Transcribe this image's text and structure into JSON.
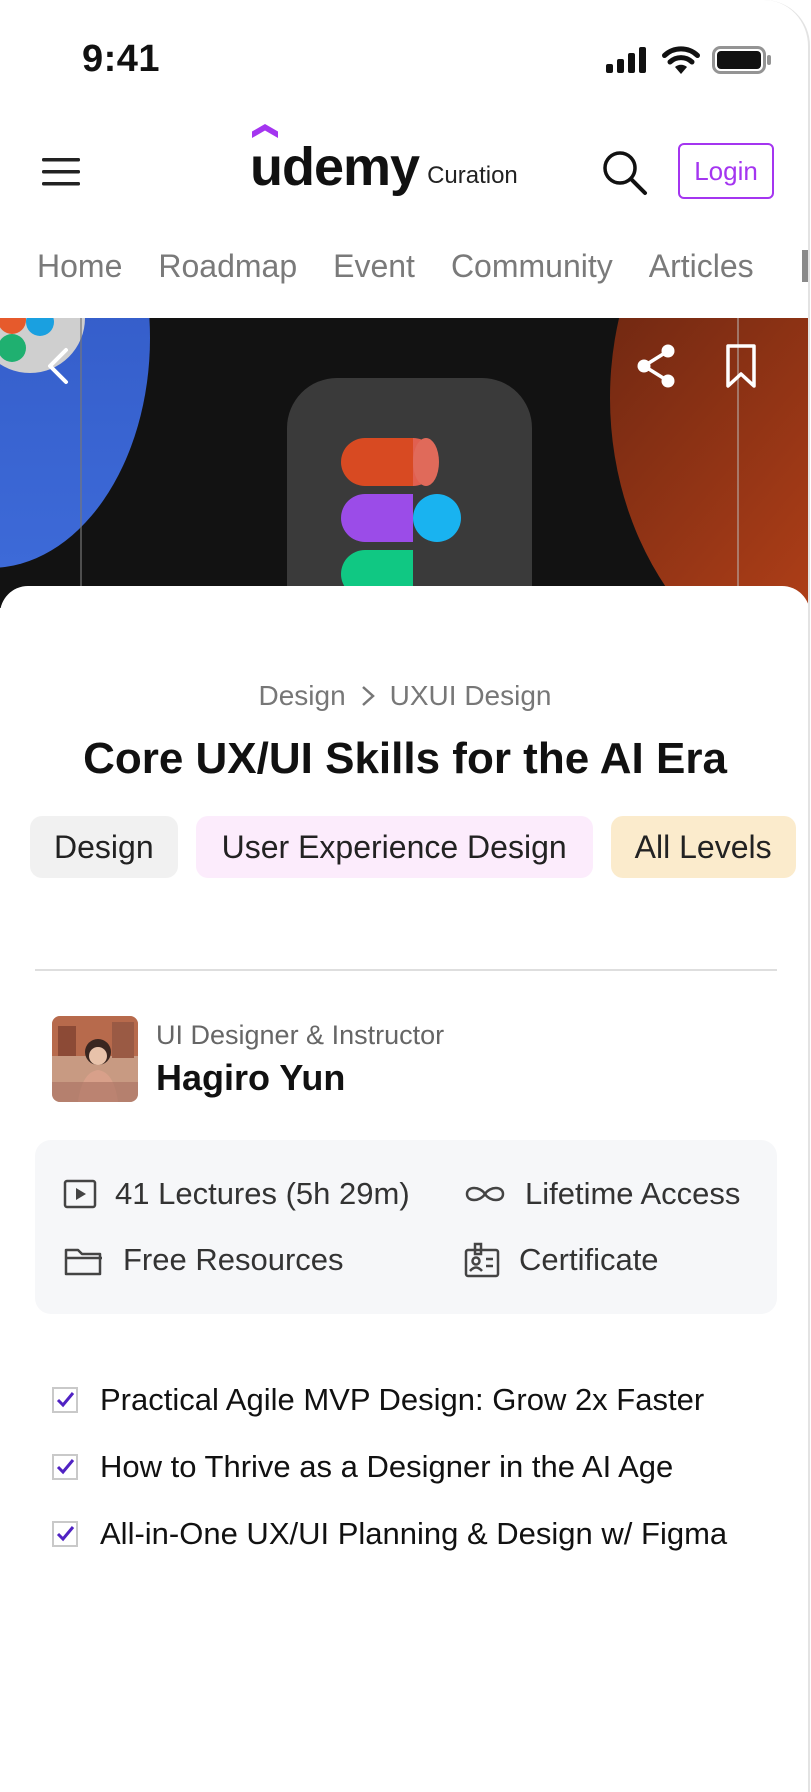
{
  "status_bar": {
    "time": "9:41"
  },
  "header": {
    "logo_word": "udemy",
    "logo_sub": "Curation",
    "login_label": "Login"
  },
  "tabs": [
    {
      "label": "Home"
    },
    {
      "label": "Roadmap"
    },
    {
      "label": "Event"
    },
    {
      "label": "Community"
    },
    {
      "label": "Articles"
    }
  ],
  "hero": {
    "icons": [
      "back-icon",
      "share-icon",
      "bookmark-icon"
    ]
  },
  "course": {
    "breadcrumb": [
      "Design",
      "UXUI Design"
    ],
    "title": "Core UX/UI Skills for the AI Era",
    "chips": [
      {
        "label": "Design",
        "bg": "#f1f1f1"
      },
      {
        "label": "User Experience Design",
        "bg": "#fcecfc"
      },
      {
        "label": "All Levels",
        "bg": "#fbebcc"
      }
    ],
    "instructor": {
      "role": "UI Designer & Instructor",
      "name": "Hagiro Yun"
    },
    "features": {
      "lectures": "41 Lectures (5h 29m)",
      "access": "Lifetime Access",
      "resources": "Free Resources",
      "certificate": "Certificate"
    },
    "highlights": [
      "Practical Agile MVP Design: Grow 2x Faster",
      "How to Thrive as a Designer in the AI Age",
      "All-in-One UX/UI Planning & Design w/ Figma"
    ]
  },
  "colors": {
    "accent": "#a435f0",
    "check": "#5022c3"
  }
}
